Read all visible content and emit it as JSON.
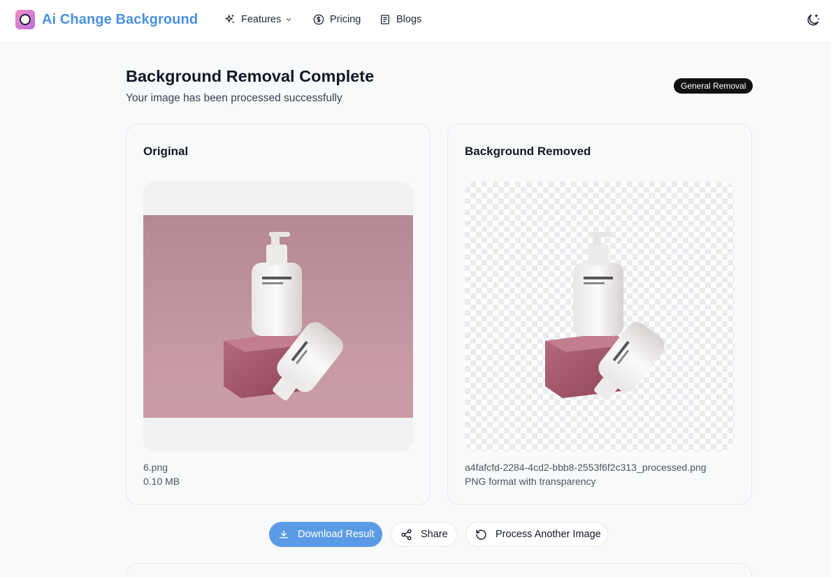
{
  "header": {
    "brand": "Ai Change Background",
    "nav": {
      "features": "Features",
      "pricing": "Pricing",
      "blogs": "Blogs"
    }
  },
  "main": {
    "title": "Background Removal Complete",
    "subtitle": "Your image has been processed successfully",
    "badge": "General Removal"
  },
  "original": {
    "title": "Original",
    "filename": "6.png",
    "size": "0.10 MB"
  },
  "result": {
    "title": "Background Removed",
    "filename": "a4fafcfd-2284-4cd2-bbb8-2553f6f2c313_processed.png",
    "format": "PNG format with transparency"
  },
  "actions": {
    "download": "Download Result",
    "share": "Share",
    "process_another": "Process Another Image"
  },
  "colors": {
    "brand": "#4a90e2",
    "primary_button": "#5b9be6",
    "badge_bg": "#111111"
  },
  "icons": [
    "sparkles-icon",
    "dollar-circle-icon",
    "document-icon",
    "chevron-down-icon",
    "moon-icon",
    "download-icon",
    "share-icon",
    "refresh-icon"
  ]
}
